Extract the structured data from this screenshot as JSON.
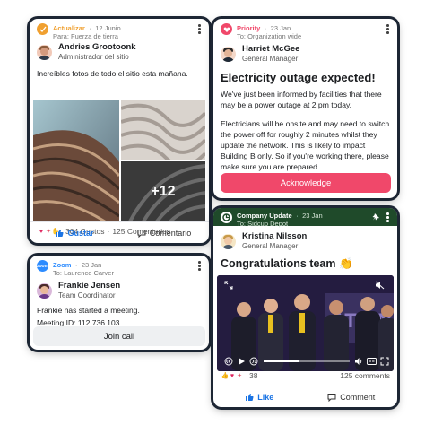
{
  "card1": {
    "app_name": "Actualizar",
    "date": "12 Junio",
    "to": "Para: Fuerza de tierra",
    "author_name": "Andries Grootoonk",
    "author_role": "Administrador del sitio",
    "body": "Increíbles fotos de todo el sitio esta mañana.",
    "more_photos": "+12",
    "likes": "304 Gustos",
    "comments": "125 Comentarios",
    "like_label": "Gustar",
    "comment_label": "Comentario",
    "accent": "#f0a030"
  },
  "card2": {
    "app_name": "Priority",
    "date": "23 Jan",
    "to": "To: Organization wide",
    "author_name": "Harriet McGee",
    "author_role": "General Manager",
    "title": "Electricity outage expected!",
    "para1": "We've just been informed by facilities that there may be a power outage at 2 pm today.",
    "para2": "Electricians will be onsite and may need to switch the power off for roughly 2 minutes whilst they update the network. This is likely to impact Building B only. So if you're working there, please make sure you are prepared.",
    "button": "Acknowledge",
    "accent": "#f0486a"
  },
  "card3": {
    "app_name": "Zoom",
    "date": "23 Jan",
    "to": "To: Laurence Carver",
    "author_name": "Frankie Jensen",
    "author_role": "Team Coordinator",
    "line1": "Frankie has started a meeting.",
    "line2": "Meeting ID: 112 736 103",
    "button": "Join call",
    "accent": "#2d8cff"
  },
  "card4": {
    "app_name": "Company Update",
    "date": "23 Jan",
    "to": "To: Sidcup Depot",
    "author_name": "Kristina Nilsson",
    "author_role": "General Manager",
    "title": "Congratulations team 👏",
    "likes": "38",
    "comments": "125 comments",
    "like_label": "Like",
    "comment_label": "Comment",
    "header_bg": "#1f4a2a",
    "video_progress": 0.42,
    "icons": [
      "photo-icon",
      "pin-icon",
      "mute-icon",
      "play-icon",
      "rewind-icon",
      "forward-icon",
      "volume-icon",
      "captions-icon",
      "fullscreen-icon"
    ]
  }
}
